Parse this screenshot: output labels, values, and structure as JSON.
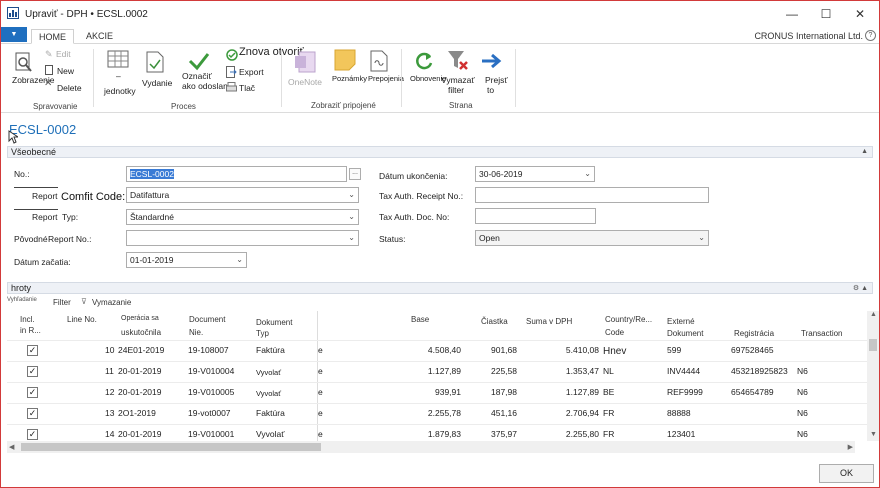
{
  "window": {
    "title": "Upraviť - DPH • ECSL.0002",
    "minimize_glyph": "—",
    "maximize_glyph": "☐",
    "close_glyph": "✕",
    "icon": "chart-app-icon"
  },
  "tabs": {
    "quick_access": "▼",
    "items": [
      {
        "label": "HOME"
      },
      {
        "label": "AKCIE"
      }
    ],
    "company": "CRONUS International Ltd.",
    "help": "?"
  },
  "ribbon": {
    "spravovanie": {
      "zobrazenie": "Zobrazenie",
      "edit": "Edit",
      "new": "New",
      "delete": "Delete",
      "group": "Spravovanie"
    },
    "proces": {
      "jednotky_prefix": "–",
      "jednotky": "jednotky",
      "vydanie": "Vydanie",
      "oznacit": "Označiť",
      "ako_odoslane": "ako odoslané",
      "znova_otvorit": "Znova otvoriť",
      "export": "Export",
      "tlac": "Tlač",
      "group": "Proces"
    },
    "zobrazit": {
      "onenote": "OneNote",
      "poznamky": "Poznámky",
      "prepojenia": "Prepojenia",
      "group": "Zobraziť pripojené"
    },
    "strana": {
      "obnovenie": "Obnovenie",
      "vymazat": "Vymazať",
      "filter": "filter",
      "prejst": "Prejsť",
      "to": "to",
      "group": "Strana"
    }
  },
  "page": {
    "title": "ECSL-0002"
  },
  "general": {
    "header": "Všeobecné",
    "caret": "▲",
    "no_label": "No.:",
    "no_value": "ECSL-0002",
    "assist_glyph": "...",
    "report_label": "Report",
    "comfit_label": "Comfit Code:",
    "comfit_value": "Datifattura",
    "report_type_label": "Report",
    "typ_label": "Typ:",
    "report_type_value": "Štandardné",
    "povodne_label": "Pôvodné",
    "report_no_label": "Report No.:",
    "report_no_value": "",
    "datum_zacatia_label": "Dátum začatia:",
    "datum_zacatia_value": "01-01-2019",
    "datum_ukoncenia_label": "Dátum ukončenia:",
    "datum_ukoncenia_value": "30-06-2019",
    "receipt_label": "Tax Auth. Receipt No.:",
    "receipt_value": "",
    "doc_no_label": "Tax Auth. Doc. No:",
    "doc_no_value": "",
    "status_label": "Status:",
    "status_value": "Open",
    "dropdown_glyph": "⌄"
  },
  "lines": {
    "header": "hroty",
    "header_icons": "⚙ ▲",
    "actions": {
      "vyhladanie": "Vyhľadanie",
      "filter": "Filter",
      "vymazanie": "Vymazanie"
    },
    "columns": {
      "incl": [
        "Incl.",
        "in R..."
      ],
      "line_no": "Line No.",
      "operacia": [
        "Operácia sa",
        "uskutočnila"
      ],
      "document_no": [
        "Document",
        "Nie."
      ],
      "document_type": [
        "Dokument",
        "Typ"
      ],
      "base": "Base",
      "ciastka": "Čiastka",
      "suma": "Suma v DPH",
      "country": [
        "Country/Re...",
        "Code"
      ],
      "externe": [
        "Externé",
        "Dokument"
      ],
      "registracia": "Registrácia",
      "transaction": "Transaction"
    },
    "rows": [
      {
        "check": "✓",
        "line": "10",
        "date": "24E01-2019",
        "doc": "19-108007",
        "type": "Faktúra",
        "arrow": "e",
        "base": "4.508,40",
        "amount": "901,68",
        "vat": "5.410,08",
        "country": "Hnev",
        "ext": "599",
        "reg": "697528465",
        "trans": ""
      },
      {
        "check": "✓",
        "line": "11",
        "date": "20-01-2019",
        "doc": "19-V010004",
        "type": "Vyvolať",
        "arrow": "e",
        "base": "1.127,89",
        "amount": "225,58",
        "vat": "1.353,47",
        "country": "NL",
        "ext": "INV4444",
        "reg": "453218925823",
        "trans": "N6"
      },
      {
        "check": "✓",
        "line": "12",
        "date": "20-01-2019",
        "doc": "19-V010005",
        "type": "Vyvolať",
        "arrow": "e",
        "base": "939,91",
        "amount": "187,98",
        "vat": "1.127,89",
        "country": "BE",
        "ext": "REF9999",
        "reg": "654654789",
        "trans": "N6"
      },
      {
        "check": "✓",
        "line": "13",
        "date": "2O1-2019",
        "doc": "19-vot0007",
        "type": "Faktúra",
        "arrow": "e",
        "base": "2.255,78",
        "amount": "451,16",
        "vat": "2.706,94",
        "country": "FR",
        "ext": "88888",
        "reg": "",
        "trans": "N6"
      },
      {
        "check": "✓",
        "line": "14",
        "date": "20-01-2019",
        "doc": "19-V010001",
        "type": "Vyvolať",
        "arrow": "e",
        "base": "1.879,83",
        "amount": "375,97",
        "vat": "2.255,80",
        "country": "FR",
        "ext": "123401",
        "reg": "",
        "trans": "N6"
      }
    ]
  },
  "footer": {
    "ok": "OK"
  }
}
